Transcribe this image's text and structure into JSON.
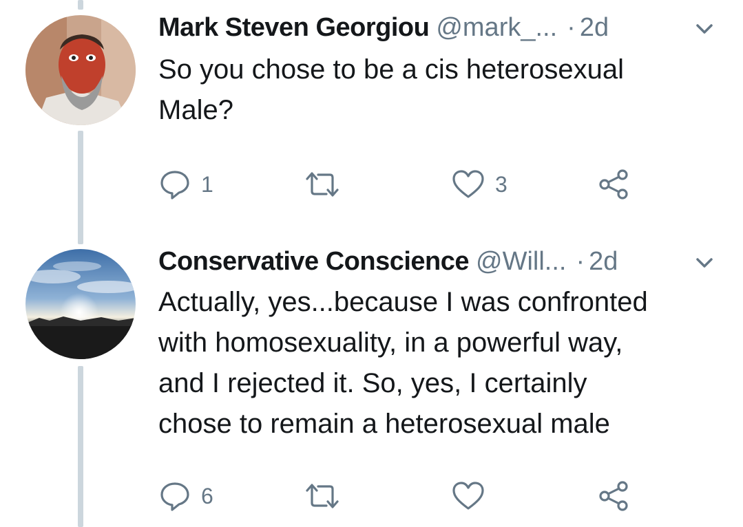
{
  "tweets": [
    {
      "name": "Mark Steven Georgiou",
      "handle": "@mark_...",
      "separator": "·",
      "time": "2d",
      "text_lines": [
        "So you chose to be a cis heterosexual",
        "Male?"
      ],
      "reply_count": "1",
      "retweet_count": "",
      "like_count": "3"
    },
    {
      "name": "Conservative Conscience",
      "handle": "@Will...",
      "separator": "·",
      "time": "2d",
      "text_lines": [
        "Actually, yes...because I was confronted",
        "with homosexuality, in a powerful way,",
        "and I rejected it.  So, yes, I certainly",
        "chose to remain a heterosexual male"
      ],
      "reply_count": "6",
      "retweet_count": "",
      "like_count": ""
    }
  ],
  "icons": {
    "reply": "speech-bubble-icon",
    "retweet": "retweet-icon",
    "like": "heart-icon",
    "share": "share-icon",
    "more": "chevron-down-icon"
  },
  "colors": {
    "text": "#14171a",
    "secondary": "#657786",
    "thread_line": "#ccd6dd"
  }
}
